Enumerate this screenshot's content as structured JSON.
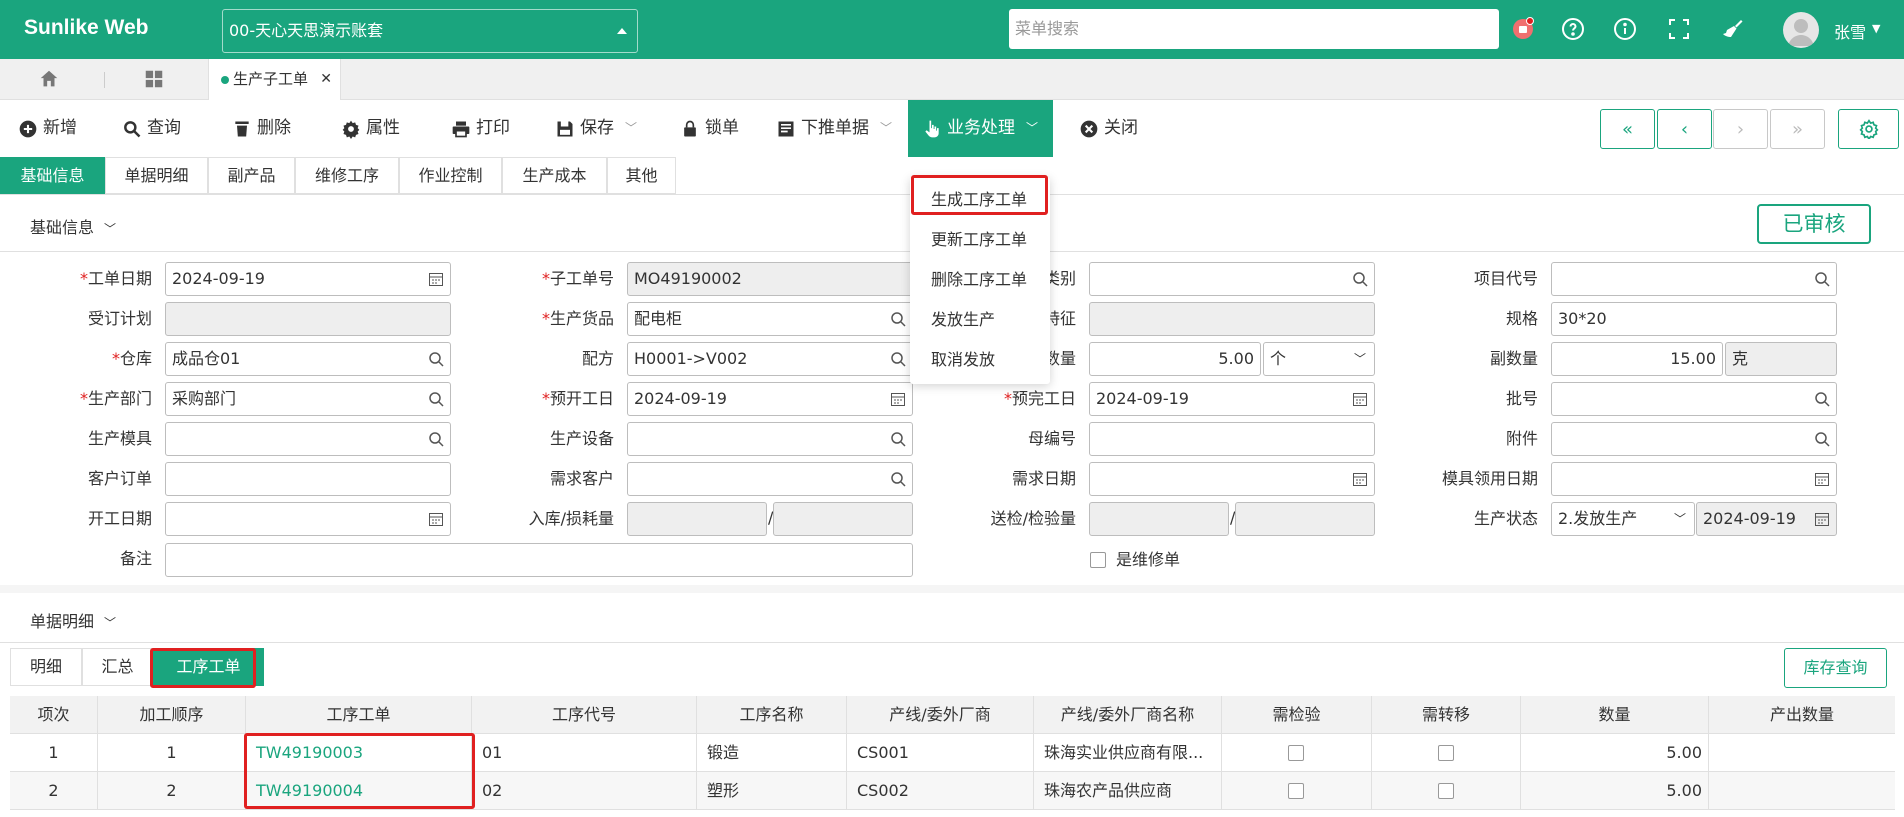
{
  "app": {
    "brand": "Sunlike Web",
    "account": "00-天心天思演示账套",
    "search_placeholder": "菜单搜索",
    "user": "张雪"
  },
  "colors": {
    "primary": "#1aa57e",
    "alert": "#e02020"
  },
  "tabs": {
    "active": "生产子工单"
  },
  "toolbar": {
    "new": "新增",
    "query": "查询",
    "delete": "删除",
    "props": "属性",
    "print": "打印",
    "save": "保存",
    "lock": "锁单",
    "push": "下推单据",
    "business": "业务处理",
    "close": "关闭"
  },
  "subtabs": [
    "基础信息",
    "单据明细",
    "副产品",
    "维修工序",
    "作业控制",
    "生产成本",
    "其他"
  ],
  "section1": "基础信息",
  "status_stamp": "已审核",
  "dropdown": [
    "生成工序工单",
    "更新工序工单",
    "删除工序工单",
    "发放生产",
    "取消发放"
  ],
  "form": {
    "order_date_label": "工单日期",
    "order_date": "2024-09-19",
    "sub_no_label": "子工单号",
    "sub_no": "MO49190002",
    "category_label": "类别",
    "project_label": "项目代号",
    "plan_label": "受订计划",
    "goods_label": "生产货品",
    "goods": "配电柜",
    "feature_label": "特征",
    "spec_label": "规格",
    "spec": "30*20",
    "warehouse_label": "仓库",
    "warehouse": "成品仓01",
    "recipe_label": "配方",
    "recipe": "H0001->V002",
    "qty_label": "数量",
    "qty": "5.00",
    "unit": "个",
    "subqty_label": "副数量",
    "subqty": "15.00",
    "subunit": "克",
    "dept_label": "生产部门",
    "dept": "采购部门",
    "start_plan_label": "预开工日",
    "start_plan": "2024-09-19",
    "end_plan_label": "预完工日",
    "end_plan": "2024-09-19",
    "batch_label": "批号",
    "mold_label": "生产模具",
    "equip_label": "生产设备",
    "parent_label": "母编号",
    "attach_label": "附件",
    "customer_order_label": "客户订单",
    "demand_customer_label": "需求客户",
    "demand_date_label": "需求日期",
    "mold_date_label": "模具领用日期",
    "start_date_label": "开工日期",
    "instock_label": "入库/损耗量",
    "inspect_label": "送检/检验量",
    "prod_status_label": "生产状态",
    "prod_status": "2.发放生产",
    "prod_status_date": "2024-09-19",
    "remark_label": "备注",
    "repair_label": "是维修单",
    "slash": "/"
  },
  "section2": "单据明细",
  "detail_tabs": [
    "明细",
    "汇总",
    "工序工单"
  ],
  "stock_btn": "库存查询",
  "table": {
    "headers": [
      "项次",
      "加工顺序",
      "工序工单",
      "工序代号",
      "工序名称",
      "产线/委外厂商",
      "产线/委外厂商名称",
      "需检验",
      "需转移",
      "数量",
      "产出数量"
    ],
    "rows": [
      [
        "1",
        "1",
        "TW49190003",
        "01",
        "锻造",
        "CS001",
        "珠海实业供应商有限...",
        "",
        "",
        "5.00",
        ""
      ],
      [
        "2",
        "2",
        "TW49190004",
        "02",
        "塑形",
        "CS002",
        "珠海农产品供应商",
        "",
        "",
        "5.00",
        ""
      ]
    ]
  }
}
